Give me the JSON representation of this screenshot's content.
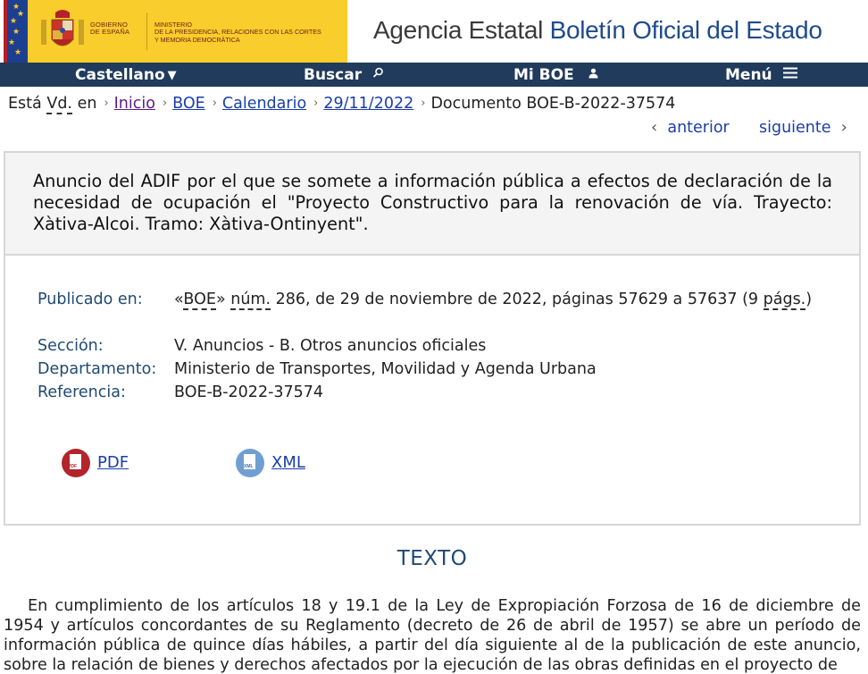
{
  "header": {
    "gov_label": [
      "GOBIERNO",
      "DE ESPAÑA"
    ],
    "ministry_label": [
      "MINISTERIO",
      "DE LA PRESIDENCIA, RELACIONES CON LAS CORTES",
      "Y MEMORIA DEMOCRÁTICA"
    ],
    "agency_prefix": "Agencia Estatal",
    "agency_name": "Boletín Oficial del Estado"
  },
  "nav": {
    "language": "Castellano",
    "search": "Buscar",
    "my_boe": "Mi BOE",
    "menu": "Menú"
  },
  "breadcrumb": {
    "prefix": "Está",
    "vd": "Vd.",
    "en": "en",
    "items": [
      "Inicio",
      "BOE",
      "Calendario",
      "29/11/2022"
    ],
    "current": "Documento BOE-B-2022-37574"
  },
  "pager": {
    "prev": "anterior",
    "next": "siguiente"
  },
  "document": {
    "title": "Anuncio del ADIF por el que se somete a información pública a efectos de declaración de la necesidad de ocupación el \"Proyecto Constructivo para la renovación de vía. Trayecto: Xàtiva-Alcoi. Tramo: Xàtiva-Ontinyent\".",
    "meta": {
      "published_label": "Publicado en:",
      "published_open": "«",
      "published_boe": "BOE",
      "published_close": "»",
      "published_num": "núm.",
      "published_rest": "286, de 29 de noviembre de 2022, páginas 57629 a 57637 (9",
      "published_pags": "págs.",
      "published_end": ")",
      "section_label": "Sección:",
      "section_value": "V. Anuncios - B. Otros anuncios oficiales",
      "department_label": "Departamento:",
      "department_value": "Ministerio de Transportes, Movilidad y Agenda Urbana",
      "reference_label": "Referencia:",
      "reference_value": "BOE-B-2022-37574"
    },
    "downloads": {
      "pdf": "PDF",
      "xml": "XML",
      "pdf_icon_text": "PDF",
      "xml_icon_text": "XML"
    }
  },
  "texto": {
    "heading": "TEXTO",
    "paragraph": "En cumplimiento de los artículos 18 y 19.1 de la Ley de Expropiación Forzosa de 16 de diciembre de 1954 y artículos concordantes de su Reglamento (decreto de 26 de abril de 1957) se abre un período de información pública de quince días hábiles, a partir del día siguiente al de la publicación de este anuncio, sobre la relación de bienes y derechos afectados por la ejecución de las obras definidas en el proyecto de"
  },
  "colors": {
    "gov_yellow": "#f9cd2b",
    "nav_bg": "#213b5c",
    "link": "#1b3ea8",
    "label": "#1f4a72"
  }
}
